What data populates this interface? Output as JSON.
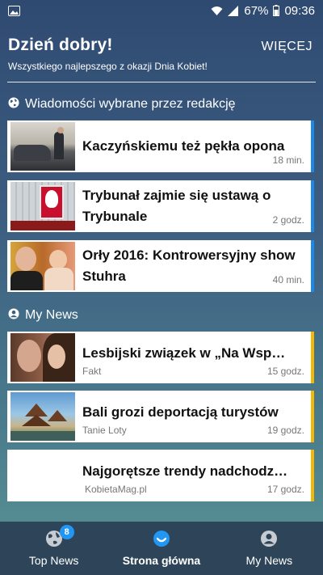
{
  "status": {
    "battery": "67%",
    "time": "09:36"
  },
  "greeting": {
    "title": "Dzień dobry!",
    "subtitle": "Wszystkiego najlepszego z okazji Dnia Kobiet!",
    "more_label": "WIĘCEJ"
  },
  "editors": {
    "heading": "Wiadomości wybrane przez redakcję",
    "accent": "#1e88e5",
    "items": [
      {
        "title": "Kaczyńskiemu też pękła opona",
        "time": "18 min.",
        "thumb_icon": "car-photo"
      },
      {
        "title": "Trybunał zajmie się ustawą o Trybunale",
        "time": "2 godz.",
        "thumb_icon": "tribunal-photo"
      },
      {
        "title": "Orły 2016: Kontrowersyjny show Stuhra",
        "time": "40 min.",
        "thumb_icon": "gala-photo"
      }
    ]
  },
  "mynews": {
    "heading": "My News",
    "accent": "#f5b800",
    "items": [
      {
        "title": "Lesbijski związek w „Na Wsp…",
        "source": "Fakt",
        "time": "15 godz.",
        "thumb_icon": "couple-photo"
      },
      {
        "title": "Bali grozi deportacją turystów",
        "source": "Tanie Loty",
        "time": "19 godz.",
        "thumb_icon": "bali-temple-photo"
      },
      {
        "title": "Najgorętsze trendy nadchodz…",
        "source": "KobietaMag.pl",
        "time": "17 godz.",
        "thumb_icon": ""
      }
    ]
  },
  "nav": {
    "items": [
      {
        "label": "Top News",
        "badge": "8",
        "icon": "globe-icon"
      },
      {
        "label": "Strona główna",
        "icon": "smile-icon"
      },
      {
        "label": "My News",
        "icon": "person-icon"
      }
    ]
  }
}
